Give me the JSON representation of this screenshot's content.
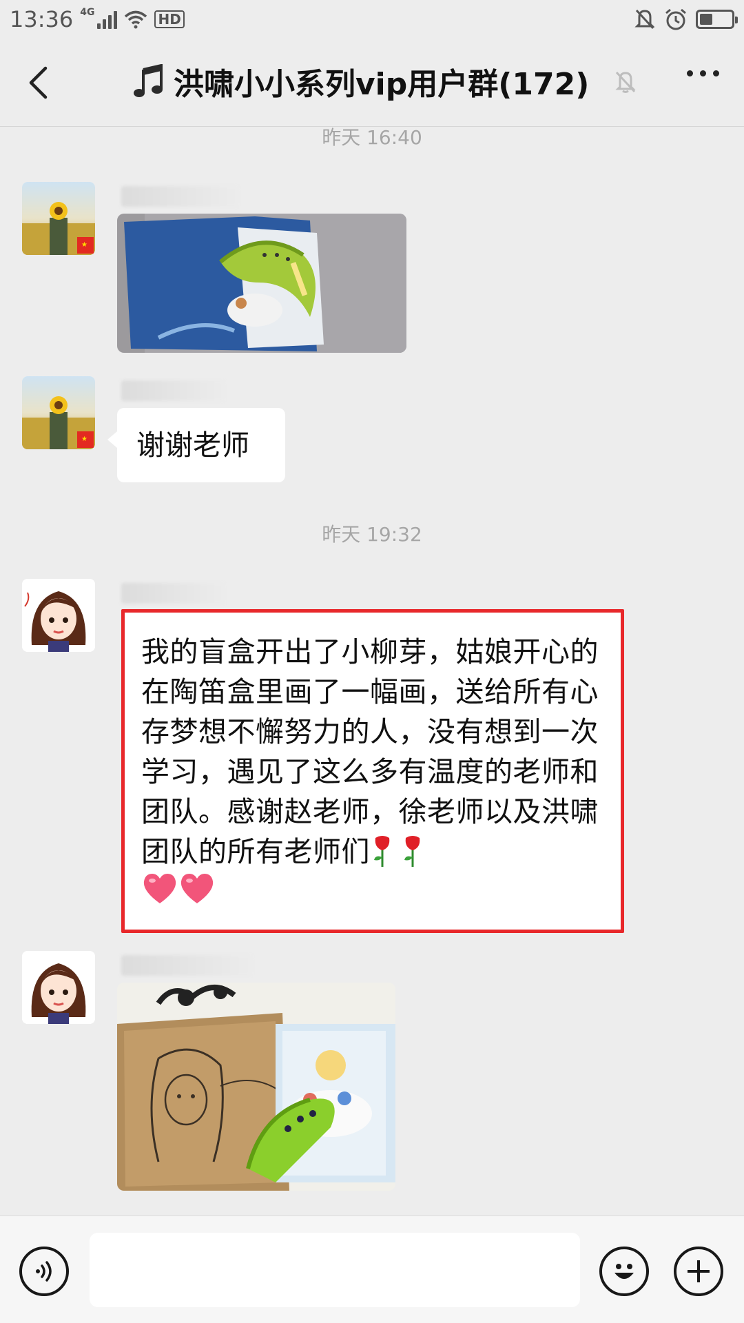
{
  "status_bar": {
    "time": "13:36",
    "network": "4G",
    "hd_label": "HD"
  },
  "header": {
    "title": "洪啸小小系列vip用户群(172)"
  },
  "messages": {
    "timestamp_1": "昨天 16:40",
    "timestamp_2": "昨天 19:32",
    "reply_text": "谢谢老师",
    "long_text": "我的盲盒开出了小柳芽，姑娘开心的在陶笛盒里画了一幅画，送给所有心存梦想不懈努力的人，没有想到一次学习，遇见了这么多有温度的老师和团队。感谢赵老师，徐老师以及洪啸团队的所有老师们"
  },
  "input_bar": {
    "value": ""
  },
  "colors": {
    "background": "#ededed",
    "highlight_border": "#e8282b",
    "bubble": "#ffffff"
  },
  "icons": [
    "back-icon",
    "music-note-icon",
    "mute-bell-icon",
    "more-icon",
    "voice-icon",
    "emoji-icon",
    "plus-icon"
  ]
}
